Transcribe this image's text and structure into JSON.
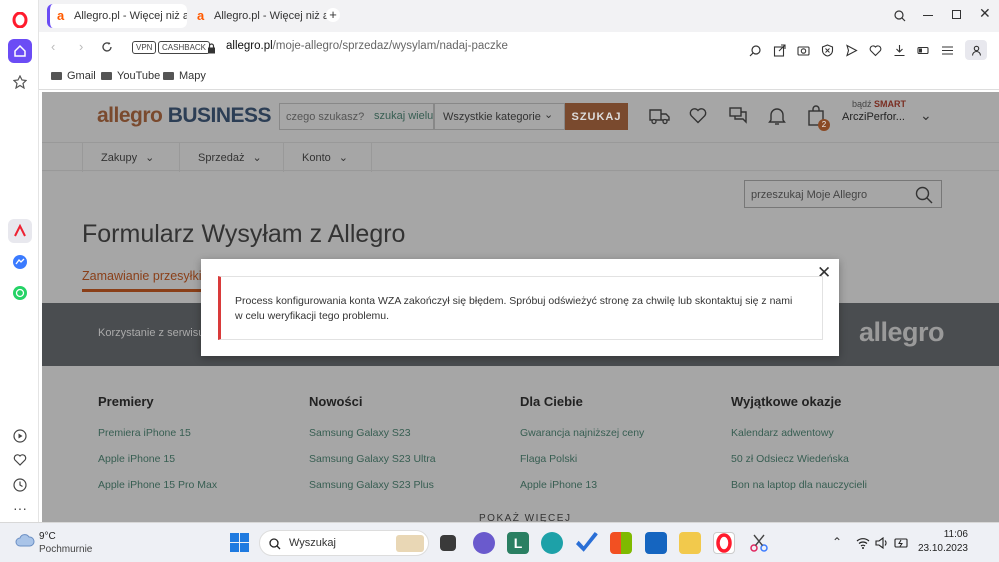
{
  "browser": {
    "tabs": [
      {
        "label": "Allegro.pl - Więcej niż aukcje",
        "favicon": "a"
      },
      {
        "label": "Allegro.pl - Więcej niż aukcje",
        "favicon": "a"
      }
    ],
    "vpn_label": "VPN",
    "cashback_label": "CASHBACK",
    "url_domain": "allegro.pl",
    "url_path": "/moje-allegro/sprzedaz/wysylam/nadaj-paczke",
    "bookmarks": [
      "Gmail",
      "YouTube",
      "Mapy"
    ]
  },
  "header": {
    "logo_main": "allegro",
    "logo_business": "BUSINESS",
    "search_placeholder": "czego szukasz?",
    "search_many": "szukaj wielu",
    "category": "Wszystkie kategorie",
    "search_button": "SZUKAJ",
    "smart_prefix": "bądź",
    "smart_label": "SMART",
    "account_name": "ArcziPerfor...",
    "cart_count": "2"
  },
  "nav": {
    "items": [
      "Zakupy",
      "Sprzedaż",
      "Konto"
    ]
  },
  "main": {
    "search_placeholder": "przeszukaj Moje Allegro",
    "title": "Formularz Wysyłam z Allegro",
    "tab_active": "Zamawianie przesyłki",
    "band_text": "Korzystanie z serwisu o",
    "band_logo": "allegro"
  },
  "modal": {
    "message": "Process konfigurowania konta WZA zakończył się błędem. Spróbuj odświeżyć stronę za chwilę lub skontaktuj się z nami w celu weryfikacji tego problemu."
  },
  "footer": {
    "columns": [
      {
        "title": "Premiery",
        "links": [
          "Premiera iPhone 15",
          "Apple iPhone 15",
          "Apple iPhone 15 Pro Max"
        ]
      },
      {
        "title": "Nowości",
        "links": [
          "Samsung Galaxy S23",
          "Samsung Galaxy S23 Ultra",
          "Samsung Galaxy S23 Plus"
        ]
      },
      {
        "title": "Dla Ciebie",
        "links": [
          "Gwarancja najniższej ceny",
          "Flaga Polski",
          "Apple iPhone 13"
        ]
      },
      {
        "title": "Wyjątkowe okazje",
        "links": [
          "Kalendarz adwentowy",
          "50 zł Odsiecz Wiedeńska",
          "Bon na laptop dla nauczycieli"
        ]
      }
    ],
    "more_label": "POKAŻ WIĘCEJ"
  },
  "taskbar": {
    "temp": "9°C",
    "weather": "Pochmurnie",
    "search_placeholder": "Wyszukaj",
    "time": "11:06",
    "date": "23.10.2023"
  },
  "colors": {
    "accent": "#ff5a00",
    "error": "#d93a3a",
    "dark_band": "#4a4d50"
  }
}
